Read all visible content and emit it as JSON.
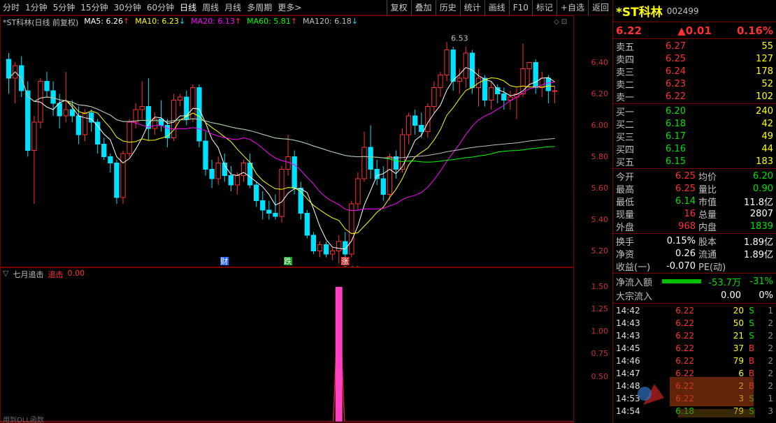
{
  "toolbar": {
    "left": [
      "分时",
      "1分钟",
      "5分钟",
      "15分钟",
      "30分钟",
      "60分钟",
      "日线",
      "周线",
      "月线",
      "多周期",
      "更多>"
    ],
    "active": "日线",
    "right": [
      "复权",
      "叠加",
      "历史",
      "统计",
      "画线",
      "F10",
      "标记",
      "+自选",
      "返回"
    ]
  },
  "legend": {
    "title": "*ST科林(日线 前复权)",
    "ma5": "MA5: 6.26",
    "ma5_arrow": "↑",
    "ma10": "MA10: 6.23",
    "ma10_arrow": "↓",
    "ma20": "MA20: 6.13",
    "ma20_arrow": "↑",
    "ma60": "MA60: 5.81",
    "ma60_arrow": "↑",
    "ma120": "MA120: 6.18",
    "ma120_arrow": "↓",
    "colors": {
      "ma5": "#ffffff",
      "ma10": "#ffff00",
      "ma20": "#ff00ff",
      "ma60": "#00ff00",
      "ma120": "#c0c0c0"
    }
  },
  "price_axis": [
    "6.40",
    "6.20",
    "6.00",
    "5.80",
    "5.60",
    "5.40",
    "5.20"
  ],
  "indicator_axis": [
    "1.50",
    "1.25",
    "1.00",
    "0.75",
    "0.50"
  ],
  "chart_data": {
    "type": "candlestick",
    "ylim": [
      5.1,
      6.62
    ],
    "annotations": {
      "high": "6.53",
      "low": "5.12"
    },
    "events": [
      "财",
      "跌",
      "涨"
    ],
    "candles": [
      [
        6.42,
        6.46,
        6.2,
        6.3
      ],
      [
        6.3,
        6.4,
        6.14,
        6.38
      ],
      [
        6.38,
        6.44,
        6.18,
        6.22
      ],
      [
        6.22,
        6.28,
        5.8,
        5.84
      ],
      [
        5.84,
        6.06,
        5.5,
        6.02
      ],
      [
        6.02,
        6.3,
        5.98,
        6.28
      ],
      [
        6.28,
        6.34,
        6.18,
        6.22
      ],
      [
        6.22,
        6.28,
        6.06,
        6.14
      ],
      [
        6.14,
        6.2,
        5.98,
        6.06
      ],
      [
        6.06,
        6.34,
        6.02,
        6.1
      ],
      [
        6.1,
        6.16,
        6.02,
        6.06
      ],
      [
        6.06,
        6.12,
        5.88,
        5.94
      ],
      [
        5.94,
        6.1,
        5.9,
        6.08
      ],
      [
        6.08,
        6.1,
        5.96,
        6.02
      ],
      [
        6.02,
        6.04,
        5.82,
        5.88
      ],
      [
        5.88,
        5.92,
        5.78,
        5.8
      ],
      [
        5.8,
        5.82,
        5.7,
        5.76
      ],
      [
        5.76,
        5.78,
        5.5,
        5.54
      ],
      [
        5.54,
        5.84,
        5.5,
        5.82
      ],
      [
        5.82,
        6.04,
        5.8,
        6.02
      ],
      [
        6.02,
        6.14,
        5.98,
        6.1
      ],
      [
        6.1,
        6.28,
        6.04,
        6.12
      ],
      [
        6.12,
        6.3,
        5.9,
        5.98
      ],
      [
        5.98,
        6.08,
        5.94,
        6.04
      ],
      [
        6.04,
        6.16,
        5.96,
        6.0
      ],
      [
        6.0,
        6.04,
        5.86,
        5.92
      ],
      [
        5.92,
        6.2,
        5.9,
        6.16
      ],
      [
        6.16,
        6.2,
        6.12,
        6.18
      ],
      [
        6.18,
        6.22,
        6.0,
        6.04
      ],
      [
        6.04,
        6.26,
        6.02,
        6.24
      ],
      [
        6.24,
        6.26,
        5.86,
        5.9
      ],
      [
        5.9,
        5.96,
        5.68,
        5.72
      ],
      [
        5.72,
        5.78,
        5.6,
        5.66
      ],
      [
        5.66,
        5.8,
        5.62,
        5.76
      ],
      [
        5.76,
        5.82,
        5.64,
        5.68
      ],
      [
        5.68,
        5.74,
        5.58,
        5.62
      ],
      [
        5.62,
        5.7,
        5.56,
        5.68
      ],
      [
        5.68,
        5.78,
        5.64,
        5.76
      ],
      [
        5.76,
        5.82,
        5.6,
        5.62
      ],
      [
        5.62,
        5.64,
        5.48,
        5.52
      ],
      [
        5.52,
        5.58,
        5.4,
        5.46
      ],
      [
        5.46,
        5.52,
        5.4,
        5.44
      ],
      [
        5.44,
        5.56,
        5.4,
        5.42
      ],
      [
        5.42,
        5.74,
        5.38,
        5.72
      ],
      [
        5.72,
        5.94,
        5.68,
        5.8
      ],
      [
        5.8,
        5.84,
        5.56,
        5.6
      ],
      [
        5.6,
        5.64,
        5.4,
        5.44
      ],
      [
        5.44,
        5.46,
        5.28,
        5.3
      ],
      [
        5.3,
        5.32,
        5.18,
        5.2
      ],
      [
        5.2,
        5.26,
        5.16,
        5.24
      ],
      [
        5.24,
        5.26,
        5.16,
        5.18
      ],
      [
        5.18,
        5.22,
        5.14,
        5.2
      ],
      [
        5.2,
        5.3,
        5.12,
        5.26
      ],
      [
        5.26,
        5.32,
        5.16,
        5.18
      ],
      [
        5.18,
        5.52,
        5.16,
        5.5
      ],
      [
        5.5,
        5.7,
        5.46,
        5.66
      ],
      [
        5.66,
        5.96,
        5.64,
        5.86
      ],
      [
        5.86,
        6.0,
        5.66,
        5.72
      ],
      [
        5.72,
        5.78,
        5.62,
        5.66
      ],
      [
        5.66,
        5.74,
        5.52,
        5.56
      ],
      [
        5.56,
        5.82,
        5.52,
        5.8
      ],
      [
        5.8,
        5.84,
        5.66,
        5.72
      ],
      [
        5.72,
        5.98,
        5.7,
        5.94
      ],
      [
        5.94,
        6.08,
        5.88,
        6.06
      ],
      [
        6.06,
        6.1,
        5.94,
        6.0
      ],
      [
        6.0,
        6.08,
        5.92,
        5.96
      ],
      [
        5.96,
        6.14,
        5.92,
        6.12
      ],
      [
        6.12,
        6.28,
        6.08,
        6.24
      ],
      [
        6.24,
        6.34,
        6.18,
        6.32
      ],
      [
        6.32,
        6.53,
        6.28,
        6.48
      ],
      [
        6.48,
        6.5,
        6.22,
        6.28
      ],
      [
        6.28,
        6.36,
        6.2,
        6.3
      ],
      [
        6.3,
        6.5,
        6.24,
        6.46
      ],
      [
        6.46,
        6.48,
        6.2,
        6.24
      ],
      [
        6.24,
        6.36,
        6.12,
        6.3
      ],
      [
        6.3,
        6.32,
        6.12,
        6.16
      ],
      [
        6.16,
        6.28,
        6.1,
        6.24
      ],
      [
        6.24,
        6.26,
        6.14,
        6.2
      ],
      [
        6.2,
        6.24,
        6.1,
        6.16
      ],
      [
        6.16,
        6.22,
        6.1,
        6.18
      ],
      [
        6.18,
        6.24,
        6.04,
        6.2
      ],
      [
        6.2,
        6.52,
        6.18,
        6.36
      ],
      [
        6.36,
        6.4,
        6.24,
        6.4
      ],
      [
        6.4,
        6.42,
        6.2,
        6.24
      ],
      [
        6.24,
        6.34,
        6.18,
        6.3
      ],
      [
        6.3,
        6.32,
        6.14,
        6.22
      ],
      [
        6.22,
        6.25,
        6.14,
        6.22
      ]
    ]
  },
  "indicator": {
    "name": "七月追击",
    "series_label": "追击",
    "value": "0.00",
    "ylim": [
      0,
      1.6
    ],
    "pulse_value": 1.5,
    "pulse_index": 52
  },
  "footnote": "用到DLL函数",
  "panel": {
    "name": "*ST科林",
    "code": "002499",
    "price": "6.22",
    "change": "▲0.01",
    "pct": "0.16%",
    "asks": [
      {
        "label": "卖五",
        "price": "6.27",
        "vol": "55"
      },
      {
        "label": "卖四",
        "price": "6.25",
        "vol": "127"
      },
      {
        "label": "卖三",
        "price": "6.24",
        "vol": "178"
      },
      {
        "label": "卖二",
        "price": "6.23",
        "vol": "52"
      },
      {
        "label": "卖一",
        "price": "6.22",
        "vol": "102"
      }
    ],
    "bids": [
      {
        "label": "买一",
        "price": "6.20",
        "vol": "240"
      },
      {
        "label": "买二",
        "price": "6.18",
        "vol": "42"
      },
      {
        "label": "买三",
        "price": "6.17",
        "vol": "49"
      },
      {
        "label": "买四",
        "price": "6.16",
        "vol": "44"
      },
      {
        "label": "买五",
        "price": "6.15",
        "vol": "183"
      }
    ],
    "stats": [
      {
        "l": "今开",
        "v": "6.25",
        "vc": "red",
        "l2": "均价",
        "v2": "6.20",
        "v2c": "green"
      },
      {
        "l": "最高",
        "v": "6.25",
        "vc": "red",
        "l2": "量比",
        "v2": "0.90",
        "v2c": "green"
      },
      {
        "l": "最低",
        "v": "6.14",
        "vc": "green",
        "l2": "市值",
        "v2": "11.8亿",
        "v2c": "white"
      },
      {
        "l": "现量",
        "v": "16",
        "vc": "red",
        "l2": "总量",
        "v2": "2807",
        "v2c": "white"
      },
      {
        "l": "外盘",
        "v": "968",
        "vc": "red",
        "l2": "内盘",
        "v2": "1839",
        "v2c": "green"
      }
    ],
    "stats2": [
      {
        "l": "换手",
        "v": "0.15%",
        "l2": "股本",
        "v2": "1.89亿"
      },
      {
        "l": "净资",
        "v": "0.26",
        "l2": "流通",
        "v2": "1.89亿"
      },
      {
        "l": "收益(一)",
        "v": "-0.070",
        "l2": "PE(动)",
        "v2": ""
      }
    ],
    "flow": [
      {
        "l": "净流入额",
        "v": "-53.7万",
        "p": "-31%"
      },
      {
        "l": "大宗流入",
        "v": "0.00",
        "p": "0%"
      }
    ],
    "ticks": [
      {
        "t": "14:42",
        "p": "6.22",
        "v": "20",
        "s": "S",
        "n": "1"
      },
      {
        "t": "14:43",
        "p": "6.22",
        "v": "50",
        "s": "S",
        "n": "2"
      },
      {
        "t": "14:43",
        "p": "6.22",
        "v": "21",
        "s": "S",
        "n": "2"
      },
      {
        "t": "14:45",
        "p": "6.22",
        "v": "37",
        "s": "B",
        "n": "2"
      },
      {
        "t": "14:46",
        "p": "6.22",
        "v": "79",
        "s": "B",
        "n": "2"
      },
      {
        "t": "14:47",
        "p": "6.22",
        "v": "6",
        "s": "B",
        "n": "2"
      },
      {
        "t": "14:48",
        "p": "6.22",
        "v": "2",
        "s": "B",
        "n": "2"
      },
      {
        "t": "14:53",
        "p": "6.22",
        "v": "3",
        "s": "S",
        "n": "1"
      },
      {
        "t": "14:54",
        "p": "6.18",
        "v": "79",
        "s": "S",
        "n": "3"
      }
    ]
  }
}
